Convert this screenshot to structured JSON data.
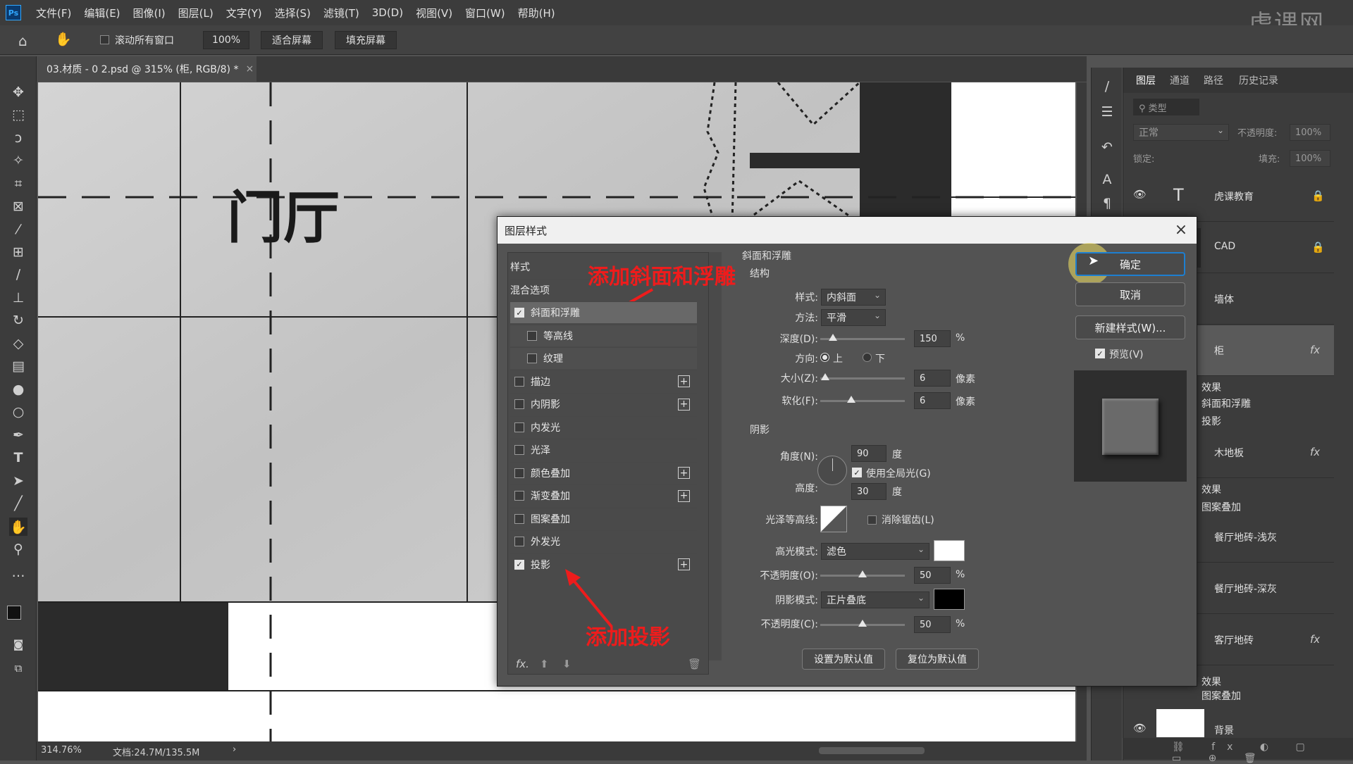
{
  "menubar": {
    "logo": "Ps",
    "items": [
      "文件(F)",
      "编辑(E)",
      "图像(I)",
      "图层(L)",
      "文字(Y)",
      "选择(S)",
      "滤镜(T)",
      "3D(D)",
      "视图(V)",
      "窗口(W)",
      "帮助(H)"
    ],
    "watermark": "虎课网"
  },
  "optionsbar": {
    "scroll_all_label": "滚动所有窗口",
    "zoom": "100%",
    "fit_screen": "适合屏幕",
    "fill_screen": "填充屏幕"
  },
  "tab": {
    "title": "03.材质 - 0 2.psd @ 315% (柜, RGB/8) *",
    "close": "×"
  },
  "canvas": {
    "room_label": "门厅"
  },
  "statusbar": {
    "zoom": "314.76%",
    "doc": "文档:24.7M/135.5M",
    "arrow": "›"
  },
  "layers_panel": {
    "tabs": [
      "图层",
      "通道",
      "路径",
      "历史记录"
    ],
    "search": "类型",
    "blend_mode": "正常",
    "opacity_label": "不透明度:",
    "opacity": "100%",
    "lock_label": "锁定:",
    "fill_label": "填充:",
    "fill": "100%",
    "layers": [
      {
        "name": "虎课教育"
      },
      {
        "name": "CAD"
      },
      {
        "name": "墙体"
      },
      {
        "name": "柜"
      },
      {
        "name": "木地板"
      },
      {
        "name": "餐厅地砖-浅灰"
      },
      {
        "name": "餐厅地砖-深灰"
      },
      {
        "name": "客厅地砖"
      },
      {
        "name": "背景"
      }
    ],
    "effects_label": "效果",
    "fx": "fx",
    "effects": {
      "gui_1": "斜面和浮雕",
      "gui_2": "投影",
      "wood": "图案叠加",
      "living": "图案叠加"
    }
  },
  "dialog": {
    "title": "图层样式",
    "close": "×",
    "styles_header": "样式",
    "blend_options": "混合选项",
    "style_items": [
      {
        "label": "斜面和浮雕",
        "checked": true,
        "plus": false
      },
      {
        "label": "等高线",
        "checked": false,
        "plus": false
      },
      {
        "label": "纹理",
        "checked": false,
        "plus": false
      },
      {
        "label": "描边",
        "checked": false,
        "plus": true
      },
      {
        "label": "内阴影",
        "checked": false,
        "plus": true
      },
      {
        "label": "内发光",
        "checked": false,
        "plus": false
      },
      {
        "label": "光泽",
        "checked": false,
        "plus": false
      },
      {
        "label": "颜色叠加",
        "checked": false,
        "plus": true
      },
      {
        "label": "渐变叠加",
        "checked": false,
        "plus": true
      },
      {
        "label": "图案叠加",
        "checked": false,
        "plus": false
      },
      {
        "label": "外发光",
        "checked": false,
        "plus": false
      },
      {
        "label": "投影",
        "checked": true,
        "plus": true
      }
    ],
    "bottom_fx": "fx.",
    "section_title": "斜面和浮雕",
    "structure": "结构",
    "style_label": "样式:",
    "style_value": "内斜面",
    "technique_label": "方法:",
    "technique_value": "平滑",
    "depth_label": "深度(D):",
    "depth": "150",
    "depth_unit": "%",
    "depth_pos": 0.15,
    "direction_label": "方向:",
    "dir_up": "上",
    "dir_down": "下",
    "size_label": "大小(Z):",
    "size": "6",
    "size_unit": "像素",
    "size_pos": 0.06,
    "soften_label": "软化(F):",
    "soften": "6",
    "soften_unit": "像素",
    "soften_pos": 0.37,
    "shading": "阴影",
    "angle_label": "角度(N):",
    "angle": "90",
    "angle_unit": "度",
    "global_light": "使用全局光(G)",
    "altitude_label": "高度:",
    "altitude": "30",
    "altitude_unit": "度",
    "gloss_label": "光泽等高线:",
    "antialias": "消除锯齿(L)",
    "highlight_label": "高光模式:",
    "highlight_mode": "滤色",
    "highlight_color": "#ffffff",
    "hl_opacity_label": "不透明度(O):",
    "hl_opacity": "50",
    "hl_unit": "%",
    "hl_pos": 0.5,
    "shadow_label": "阴影模式:",
    "shadow_mode": "正片叠底",
    "shadow_color": "#000000",
    "sh_opacity_label": "不透明度(C):",
    "sh_opacity": "50",
    "sh_unit": "%",
    "sh_pos": 0.5,
    "set_default": "设置为默认值",
    "reset_default": "复位为默认值",
    "ok": "确定",
    "cancel": "取消",
    "new_style": "新建样式(W)...",
    "preview": "预览(V)"
  },
  "annotations": {
    "bevel": "添加斜面和浮雕",
    "shadow": "添加投影"
  }
}
